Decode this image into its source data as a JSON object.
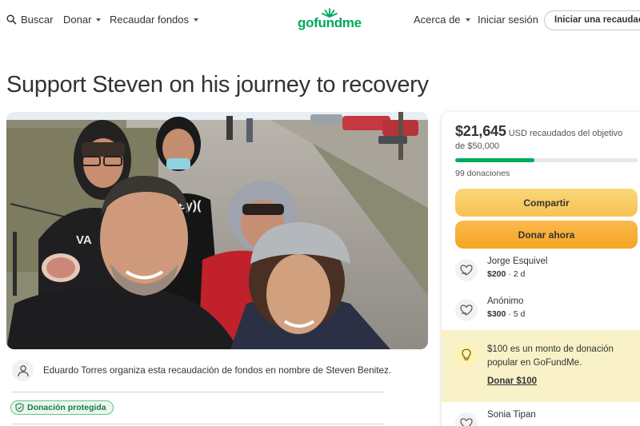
{
  "header": {
    "search_label": "Buscar",
    "donate_label": "Donar",
    "fundraise_label": "Recaudar fondos",
    "logo_text": "gofundme",
    "about_label": "Acerca de",
    "login_label": "Iniciar sesión",
    "start_label": "Iniciar una recaudación"
  },
  "campaign": {
    "title": "Support Steven on his journey to recovery",
    "organizer_text": "Eduardo Torres organiza esta recaudación de fondos en nombre de Steven Benitez.",
    "protected_label": "Donación protegida"
  },
  "stats": {
    "raised": "$21,645",
    "raised_suffix": "USD recaudados del objetivo de $50,000",
    "progress_fraction": 0.433,
    "donations_count": "99 donaciones",
    "share_label": "Compartir",
    "donate_now_label": "Donar ahora"
  },
  "donations": [
    {
      "name": "Jorge Esquivel",
      "amount": "$200",
      "time": "2 d"
    },
    {
      "name": "Anónimo",
      "amount": "$300",
      "time": "5 d"
    },
    {
      "name": "Sonia Tipan",
      "amount": "",
      "time": ""
    }
  ],
  "suggestion": {
    "text": "$100 es un monto de donación popular en GoFundMe.",
    "link_label": "Donar $100"
  },
  "colors": {
    "brand_green": "#02a95c",
    "share_yellow": "#f6c251",
    "donate_orange": "#f5a623",
    "suggest_bg": "#f9f2c8"
  },
  "icons": [
    "search-icon",
    "sprout-logo-icon",
    "user-icon",
    "shield-check-icon",
    "donor-heart-icon",
    "lightbulb-icon"
  ]
}
